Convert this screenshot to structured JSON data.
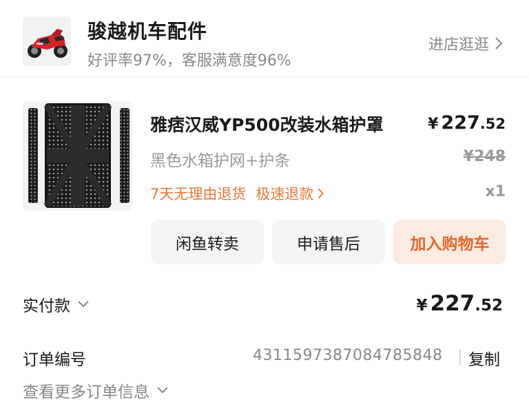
{
  "shop": {
    "name": "骏越机车配件",
    "rating": "好评率97%，客服满意度96%",
    "visit_label": "进店逛逛",
    "logo_icon": "motorcycle-image"
  },
  "product": {
    "title": "雅痞汉威YP500改装水箱护罩",
    "sku": "黑色水箱护网+护条",
    "price_currency": "¥",
    "price_int": "227",
    "price_dec": ".52",
    "original_price": "¥248",
    "service_return": "7天无理由退货",
    "service_refund": "极速退款",
    "quantity": "x1",
    "image_icon": "radiator-guard-image"
  },
  "actions": {
    "resell": "闲鱼转卖",
    "aftersale": "申请售后",
    "add_cart": "加入购物车"
  },
  "payment": {
    "label": "实付款",
    "currency": "¥",
    "amount_int": "227",
    "amount_dec": ".52"
  },
  "order": {
    "label": "订单编号",
    "number": "4311597387084785848",
    "copy_label": "复制",
    "more_label": "查看更多订单信息"
  },
  "colors": {
    "accent_orange": "#e87a35",
    "cart_bg": "#fcebe0",
    "button_bg": "#f3f4f6",
    "muted_text": "#888888"
  }
}
